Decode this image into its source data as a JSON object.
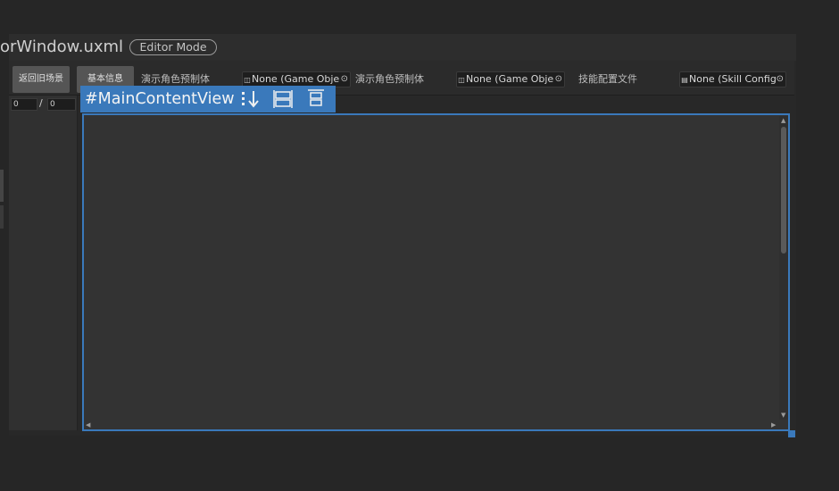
{
  "document": {
    "title": "orWindow.uxml",
    "mode_badge": "Editor Mode"
  },
  "toolbar": {
    "back_button_label": "返回旧场景",
    "info_button_label": "基本信息",
    "fields": [
      {
        "label": "演示角色预制体",
        "value": "None (Game Obje",
        "icon": "gameobject-icon"
      },
      {
        "label": "演示角色预制体",
        "value": "None (Game Obje",
        "icon": "gameobject-icon"
      },
      {
        "label": "技能配置文件",
        "value": "None (Skill Config",
        "icon": "file-icon"
      }
    ]
  },
  "frame_counter": {
    "current": "0",
    "separator": "/",
    "total": "0"
  },
  "highlight": {
    "element_name": "#MainContentView",
    "icons": [
      "flex-direction-column-icon",
      "align-stretch-icon",
      "justify-start-icon"
    ]
  },
  "colors": {
    "highlight": "#3a79bb",
    "background": "#262626",
    "panel": "#333333"
  }
}
